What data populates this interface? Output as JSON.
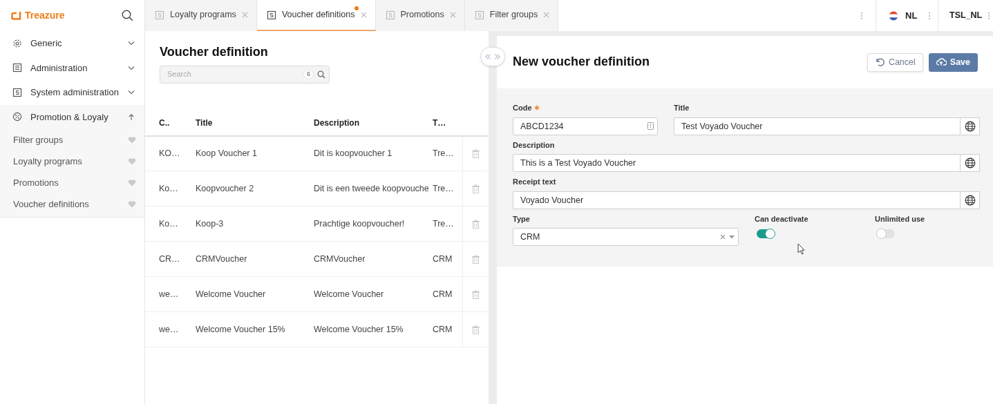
{
  "sidebar": {
    "logo": "Treazure",
    "items": [
      {
        "label": "Generic",
        "expanded": false
      },
      {
        "label": "Administration",
        "expanded": false
      },
      {
        "label": "System administration",
        "expanded": false
      },
      {
        "label": "Promotion & Loyaly",
        "expanded": true,
        "children": [
          {
            "label": "Filter groups"
          },
          {
            "label": "Loyalty programs"
          },
          {
            "label": "Promotions"
          },
          {
            "label": "Voucher definitions"
          }
        ]
      }
    ]
  },
  "tabs": [
    {
      "label": "Loyalty programs",
      "selected": false,
      "modified": false
    },
    {
      "label": "Voucher definitions",
      "selected": true,
      "modified": true
    },
    {
      "label": "Promotions",
      "selected": false,
      "modified": false
    },
    {
      "label": "Filter groups",
      "selected": false,
      "modified": false
    }
  ],
  "header": {
    "language": "NL",
    "tenant": "TSL_NL"
  },
  "list": {
    "title": "Voucher definition",
    "search": {
      "placeholder": "Search",
      "count": "6"
    },
    "columns": [
      "C..",
      "Title",
      "Description",
      "T…"
    ],
    "rows": [
      [
        "KO…",
        "Koop Voucher 1",
        "Dit is koopvoucher 1",
        "Tre…"
      ],
      [
        "Ko…",
        "Koopvoucher 2",
        "Dit is een tweede koopvouche",
        "Tre…"
      ],
      [
        "Ko…",
        "Koop-3",
        "Prachtige koopvoucher!",
        "Tre…"
      ],
      [
        "CR…",
        "CRMVoucher",
        "CRMVoucher",
        "CRM"
      ],
      [
        "we…",
        "Welcome Voucher",
        "Welcome Voucher",
        "CRM"
      ],
      [
        "we…",
        "Welcome Voucher 15%",
        "Welcome Voucher 15%",
        "CRM"
      ]
    ]
  },
  "form": {
    "title": "New voucher definition",
    "buttons": [
      {
        "label": "Cancel",
        "kind": "secondary"
      },
      {
        "label": "Save",
        "kind": "primary"
      }
    ],
    "rows": [
      [
        {
          "kind": "text",
          "label": "Code",
          "value": "ABCD1234",
          "required": true,
          "translatable": false
        },
        {
          "kind": "text",
          "label": "Title",
          "value": "Test Voyado Voucher",
          "required": false,
          "translatable": true
        }
      ],
      [
        {
          "kind": "text",
          "label": "Description",
          "value": "This is a Test Voyado Voucher",
          "required": false,
          "translatable": true
        }
      ],
      [
        {
          "kind": "text",
          "label": "Receipt text",
          "value": "Voyado Voucher",
          "required": false,
          "translatable": true
        }
      ],
      [
        {
          "kind": "select",
          "label": "Type",
          "value": "CRM"
        },
        {
          "kind": "switch",
          "label": "Can deactivate",
          "on": true
        },
        {
          "kind": "switch",
          "label": "Unlimited use",
          "on": false
        }
      ]
    ]
  }
}
